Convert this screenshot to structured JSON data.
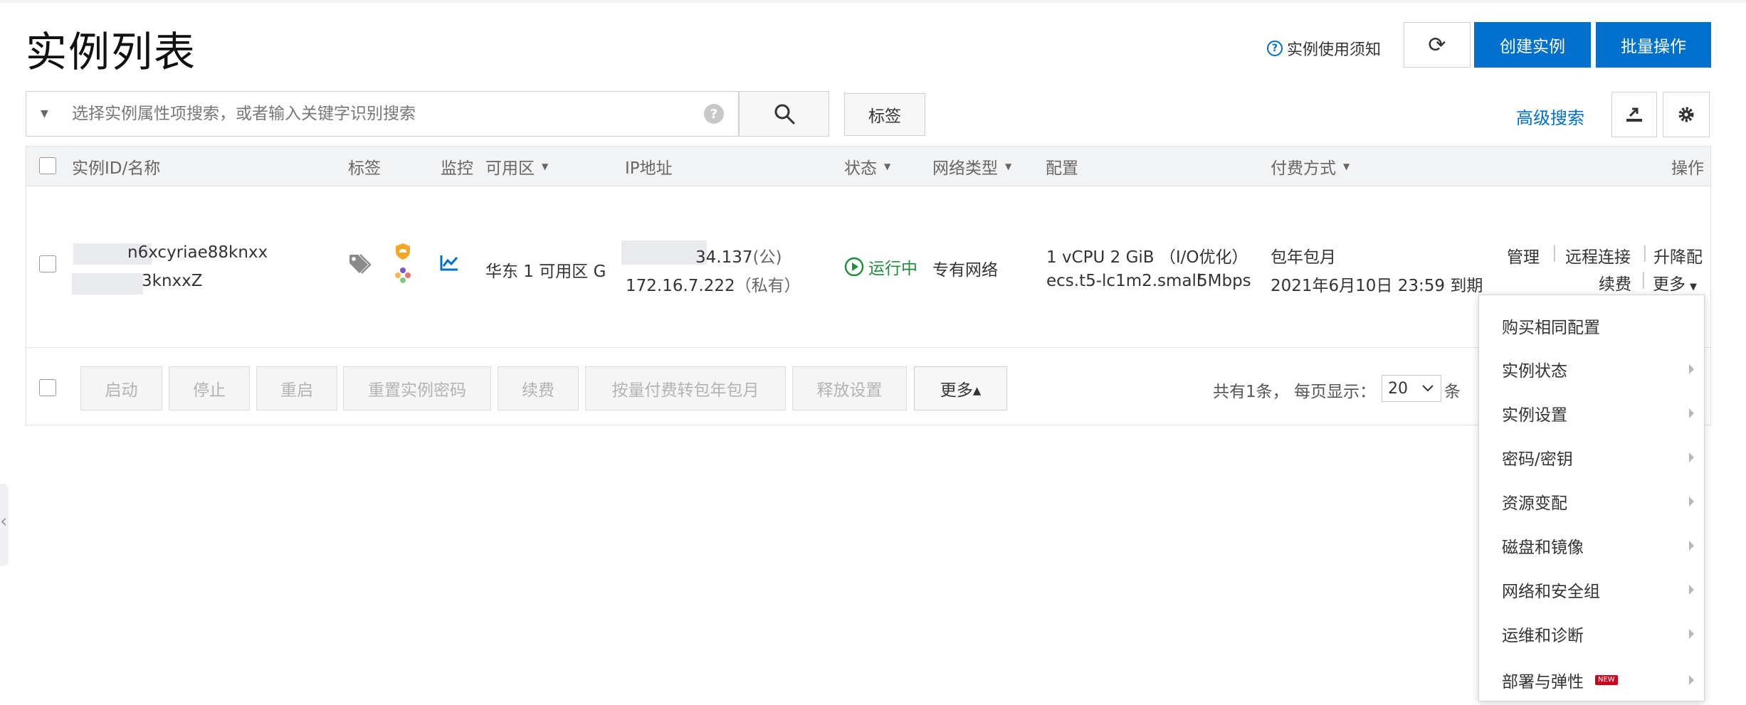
{
  "page": {
    "title": "实例列表"
  },
  "header": {
    "notice_label": "实例使用须知",
    "notice_icon": "?",
    "refresh_icon": "⟳",
    "create_label": "创建实例",
    "batch_label": "批量操作"
  },
  "search": {
    "placeholder": "选择实例属性项搜索，或者输入关键字识别搜索",
    "help_icon": "?",
    "tag_button": "标签",
    "advanced_label": "高级搜索"
  },
  "table": {
    "columns": {
      "id_name": "实例ID/名称",
      "tag": "标签",
      "monitor": "监控",
      "zone": "可用区",
      "ip": "IP地址",
      "status": "状态",
      "network": "网络类型",
      "config": "配置",
      "billing": "付费方式",
      "actions": "操作"
    },
    "row": {
      "instance_id": "n6xcyriae88knxx",
      "instance_name": "3knxxZ",
      "zone": "华东 1 可用区 G",
      "public_ip": "34.137",
      "public_suffix": "(公)",
      "private_ip": "172.16.7.222",
      "private_suffix": "（私有）",
      "status": "运行中",
      "network": "专有网络",
      "config_spec": "1 vCPU 2 GiB （I/O优化）",
      "config_type": "ecs.t5-lc1m2.small",
      "bandwidth": "5Mbps",
      "billing_type": "包年包月",
      "expire": "2021年6月10日 23:59 到期",
      "actions": {
        "manage": "管理",
        "remote": "远程连接",
        "upgrade": "升降配",
        "renew": "续费",
        "more": "更多"
      }
    },
    "footer": {
      "buttons": {
        "start": "启动",
        "stop": "停止",
        "restart": "重启",
        "reset_password": "重置实例密码",
        "renew": "续费",
        "convert": "按量付费转包年包月",
        "release": "释放设置",
        "more": "更多▴"
      },
      "total": "共有1条，",
      "per_page_label": "每页显示：",
      "per_page": "20",
      "unit": "条"
    }
  },
  "more_menu": {
    "items": [
      {
        "label": "购买相同配置"
      },
      {
        "label": "实例状态"
      },
      {
        "label": "实例设置"
      },
      {
        "label": "密码/密钥"
      },
      {
        "label": "资源变配"
      },
      {
        "label": "磁盘和镜像"
      },
      {
        "label": "网络和安全组"
      },
      {
        "label": "运维和诊断"
      },
      {
        "label": "部署与弹性",
        "badge": "NEW"
      }
    ]
  }
}
